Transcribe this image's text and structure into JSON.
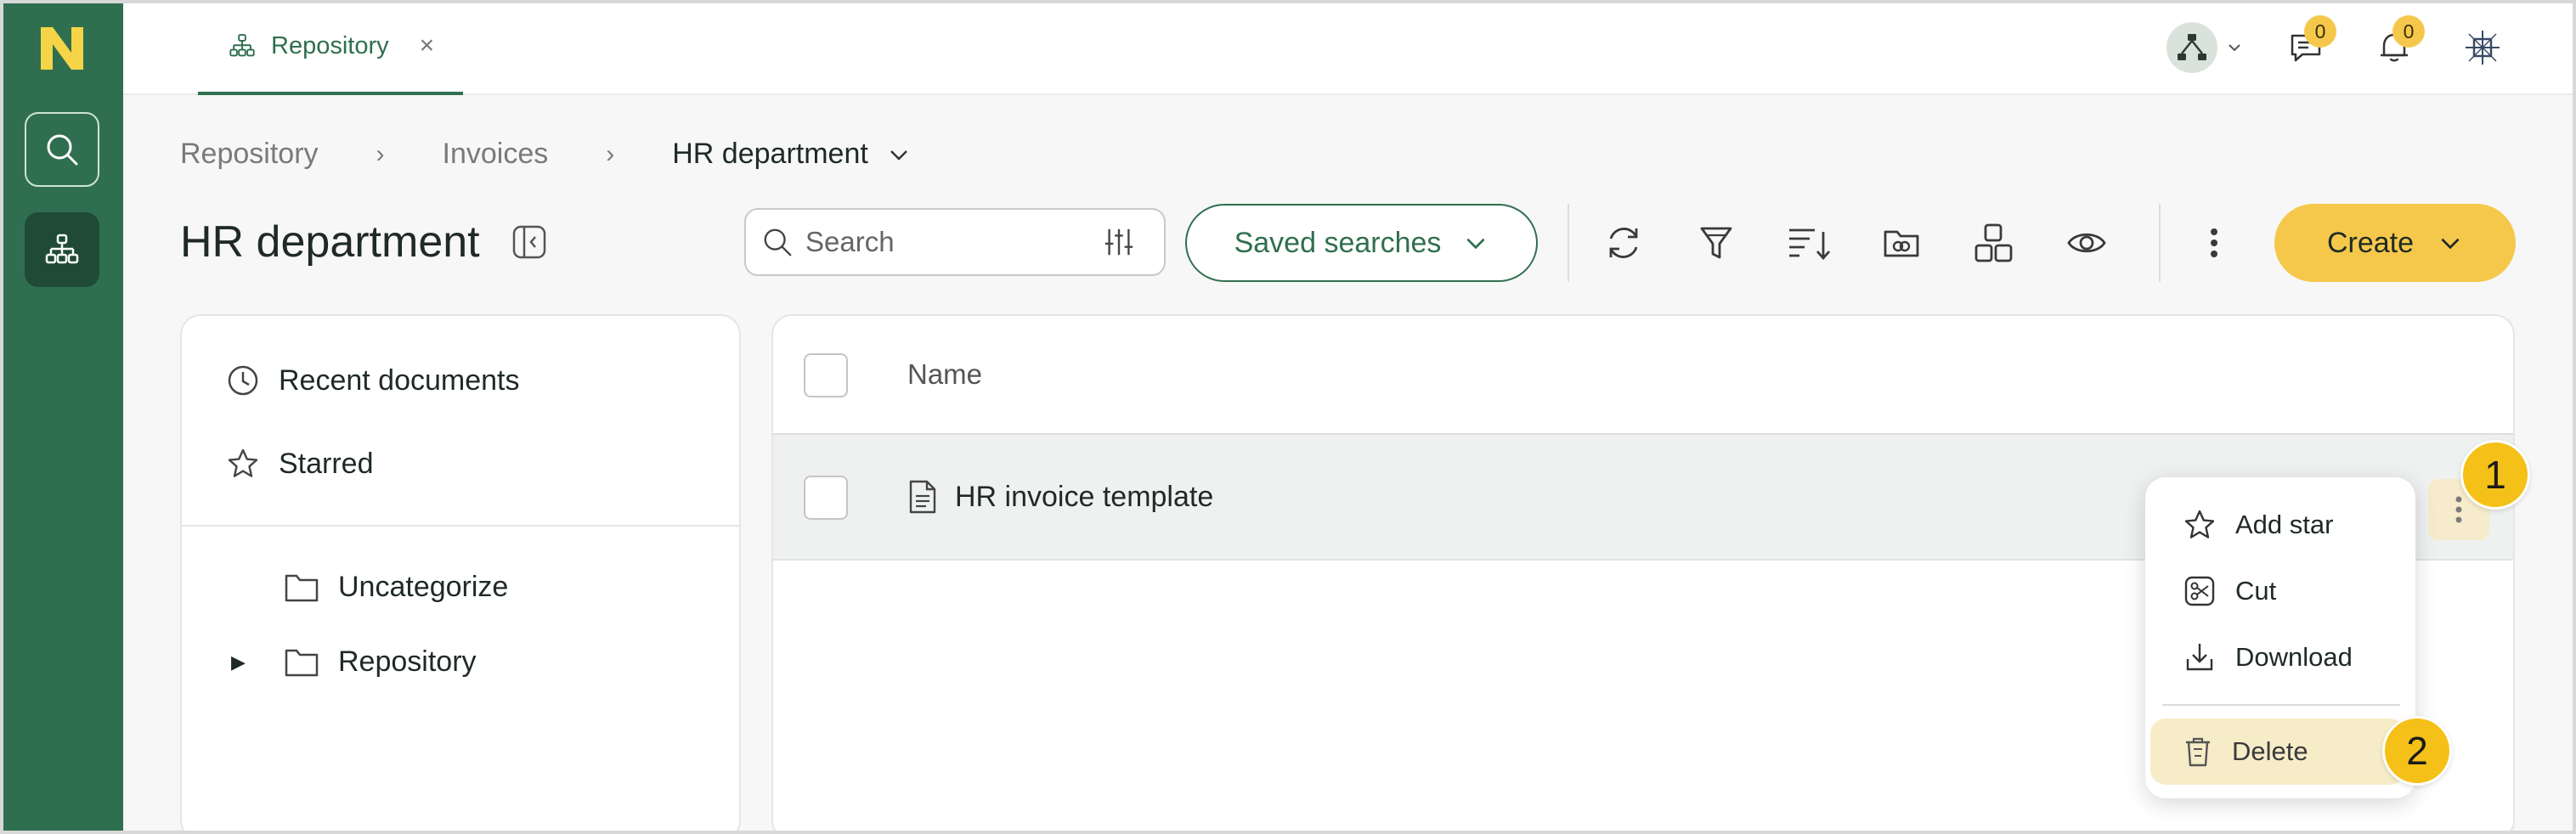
{
  "rail": {
    "logo": "N",
    "accent": "#2f6f4f"
  },
  "tab": {
    "label": "Repository",
    "close": "×"
  },
  "header": {
    "chat_badge": "0",
    "bell_badge": "0"
  },
  "breadcrumb": {
    "items": [
      "Repository",
      "Invoices"
    ],
    "current": "HR department",
    "separator": "›"
  },
  "page": {
    "title": "HR department"
  },
  "search": {
    "placeholder": "Search"
  },
  "toolbar": {
    "saved_searches": "Saved searches",
    "create": "Create"
  },
  "sidebar": {
    "recent": "Recent documents",
    "starred": "Starred",
    "folders": [
      {
        "label": "Uncategorize"
      },
      {
        "label": "Repository",
        "expander": "▶"
      }
    ]
  },
  "table": {
    "column_name": "Name",
    "rows": [
      {
        "name": "HR invoice template"
      }
    ]
  },
  "context_menu": {
    "items": [
      "Add star",
      "Cut",
      "Download"
    ],
    "delete": "Delete"
  },
  "steps": {
    "one": "1",
    "two": "2"
  },
  "colors": {
    "primary": "#2f6f4f",
    "highlight": "#f5c84c",
    "step": "#f5c118"
  }
}
